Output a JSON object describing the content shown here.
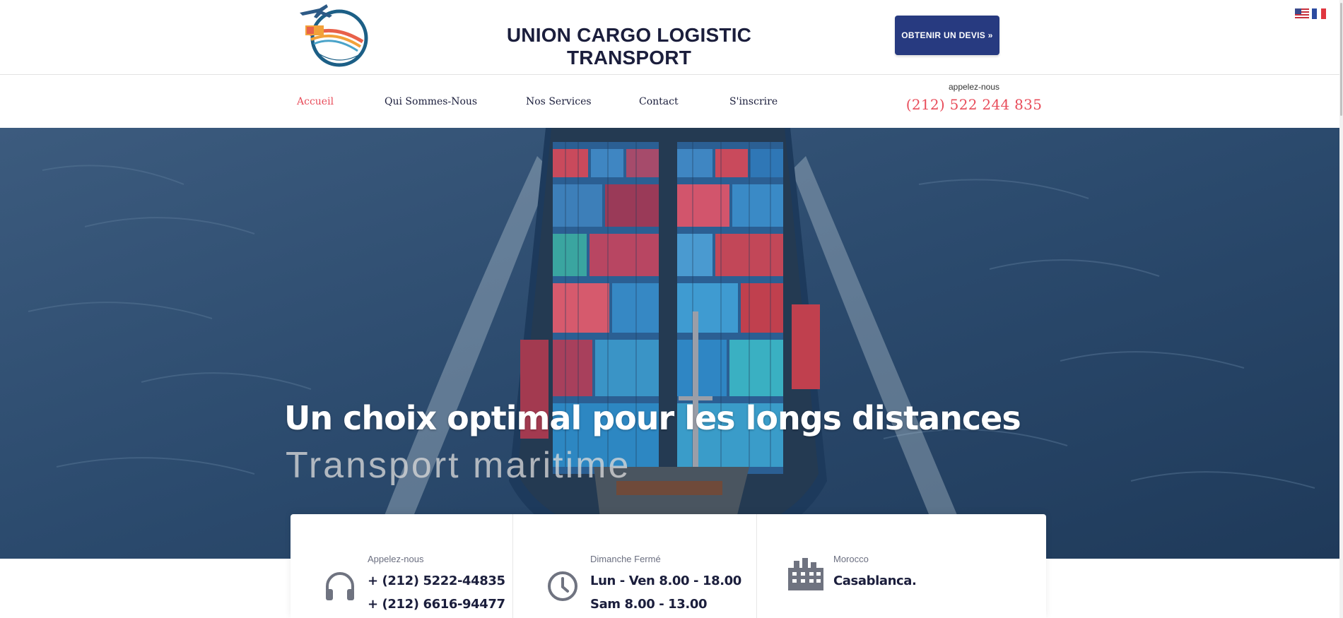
{
  "header": {
    "site_title": "UNION CARGO LOGISTIC TRANSPORT",
    "quote_button": "OBTENIR UN DEVIS »"
  },
  "nav": {
    "items": [
      {
        "label": "Accueil",
        "active": true
      },
      {
        "label": "Qui Sommes-Nous",
        "active": false
      },
      {
        "label": "Nos Services",
        "active": false
      },
      {
        "label": "Contact",
        "active": false
      },
      {
        "label": "S'inscrire",
        "active": false
      }
    ],
    "call_label": "appelez-nous",
    "call_number": "(212) 522 244 835"
  },
  "hero": {
    "title": "Un choix optimal pour les longs distances",
    "subtitle": "Transport maritime"
  },
  "info": {
    "phone": {
      "label": "Appelez-nous",
      "line1": "+ (212) 5222-44835",
      "line2": "+ (212) 6616-94477",
      "icon": "headset-icon"
    },
    "hours": {
      "label": "Dimanche Fermé",
      "line1": "Lun - Ven 8.00 - 18.00",
      "line2": "Sam 8.00 - 13.00",
      "icon": "clock-icon"
    },
    "location": {
      "label": "Morocco",
      "line1": "Casablanca.",
      "icon": "building-icon"
    }
  },
  "colors": {
    "accent": "#e84c5a",
    "primary": "#273a80",
    "dark_text": "#1b1e3c"
  }
}
